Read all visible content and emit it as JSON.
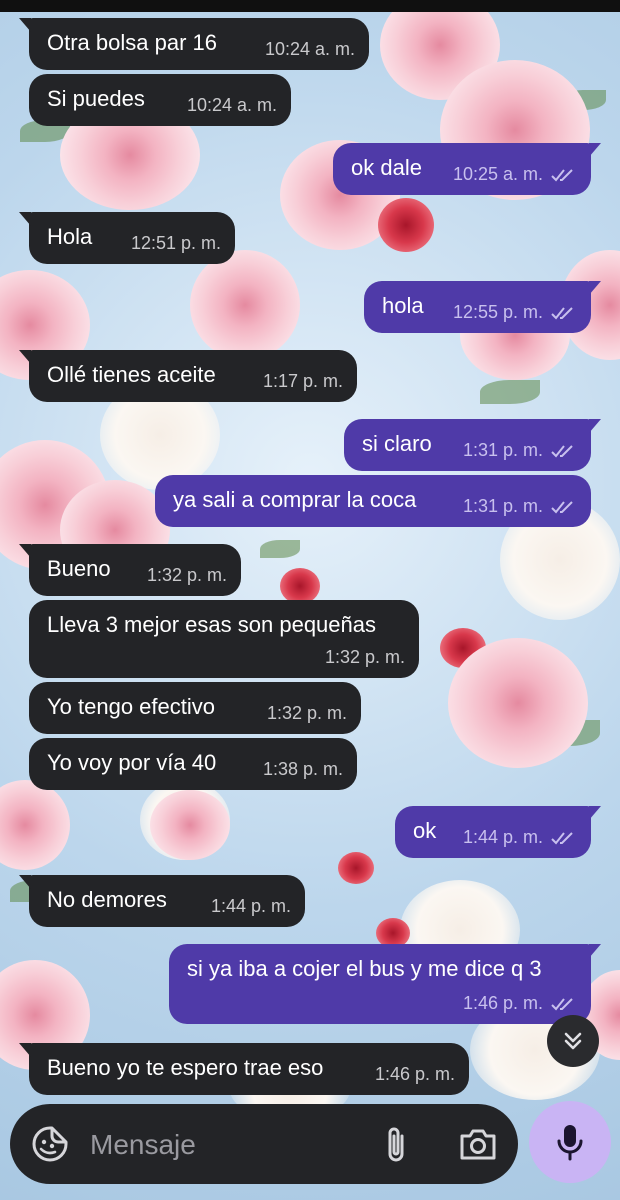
{
  "conversation": {
    "messages": [
      {
        "text": "Otra bolsa par 16",
        "time": "10:24 a. m.",
        "direction": "in",
        "status": ""
      },
      {
        "text": "Si puedes",
        "time": "10:24 a. m.",
        "direction": "in",
        "status": ""
      },
      {
        "text": "ok dale",
        "time": "10:25 a. m.",
        "direction": "out",
        "status": "read"
      },
      {
        "text": "Hola",
        "time": "12:51 p. m.",
        "direction": "in",
        "status": ""
      },
      {
        "text": "hola",
        "time": "12:55 p. m.",
        "direction": "out",
        "status": "read"
      },
      {
        "text": "Ollé tienes aceite",
        "time": "1:17 p. m.",
        "direction": "in",
        "status": ""
      },
      {
        "text": "si claro",
        "time": "1:31 p. m.",
        "direction": "out",
        "status": "read"
      },
      {
        "text": "ya sali a comprar la coca",
        "time": "1:31 p. m.",
        "direction": "out",
        "status": "read"
      },
      {
        "text": "Bueno",
        "time": "1:32 p. m.",
        "direction": "in",
        "status": ""
      },
      {
        "text": "Lleva 3 mejor esas son pequeñas",
        "time": "1:32 p. m.",
        "direction": "in",
        "status": ""
      },
      {
        "text": "Yo tengo efectivo",
        "time": "1:32 p. m.",
        "direction": "in",
        "status": ""
      },
      {
        "text": "Yo voy por vía 40",
        "time": "1:38 p. m.",
        "direction": "in",
        "status": ""
      },
      {
        "text": "ok",
        "time": "1:44 p. m.",
        "direction": "out",
        "status": "read"
      },
      {
        "text": "No demores",
        "time": "1:44 p. m.",
        "direction": "in",
        "status": ""
      },
      {
        "text": "si ya iba a cojer el bus y me dice q 3",
        "time": "1:46 p. m.",
        "direction": "out",
        "status": "read"
      },
      {
        "text": "Bueno yo te espero trae eso",
        "time": "1:46 p. m.",
        "direction": "in",
        "status": ""
      }
    ]
  },
  "composer": {
    "placeholder": "Mensaje",
    "icons": {
      "emoji": "sticker-smile-icon",
      "attach": "paperclip-icon",
      "camera": "camera-icon",
      "mic": "microphone-icon",
      "scroll": "double-chevron-down-icon",
      "read": "double-check-icon"
    }
  },
  "colors": {
    "incoming_bubble": "#232427",
    "outgoing_bubble": "#4f3aa8",
    "mic_button": "#c9b4f4",
    "composer": "#232427"
  }
}
